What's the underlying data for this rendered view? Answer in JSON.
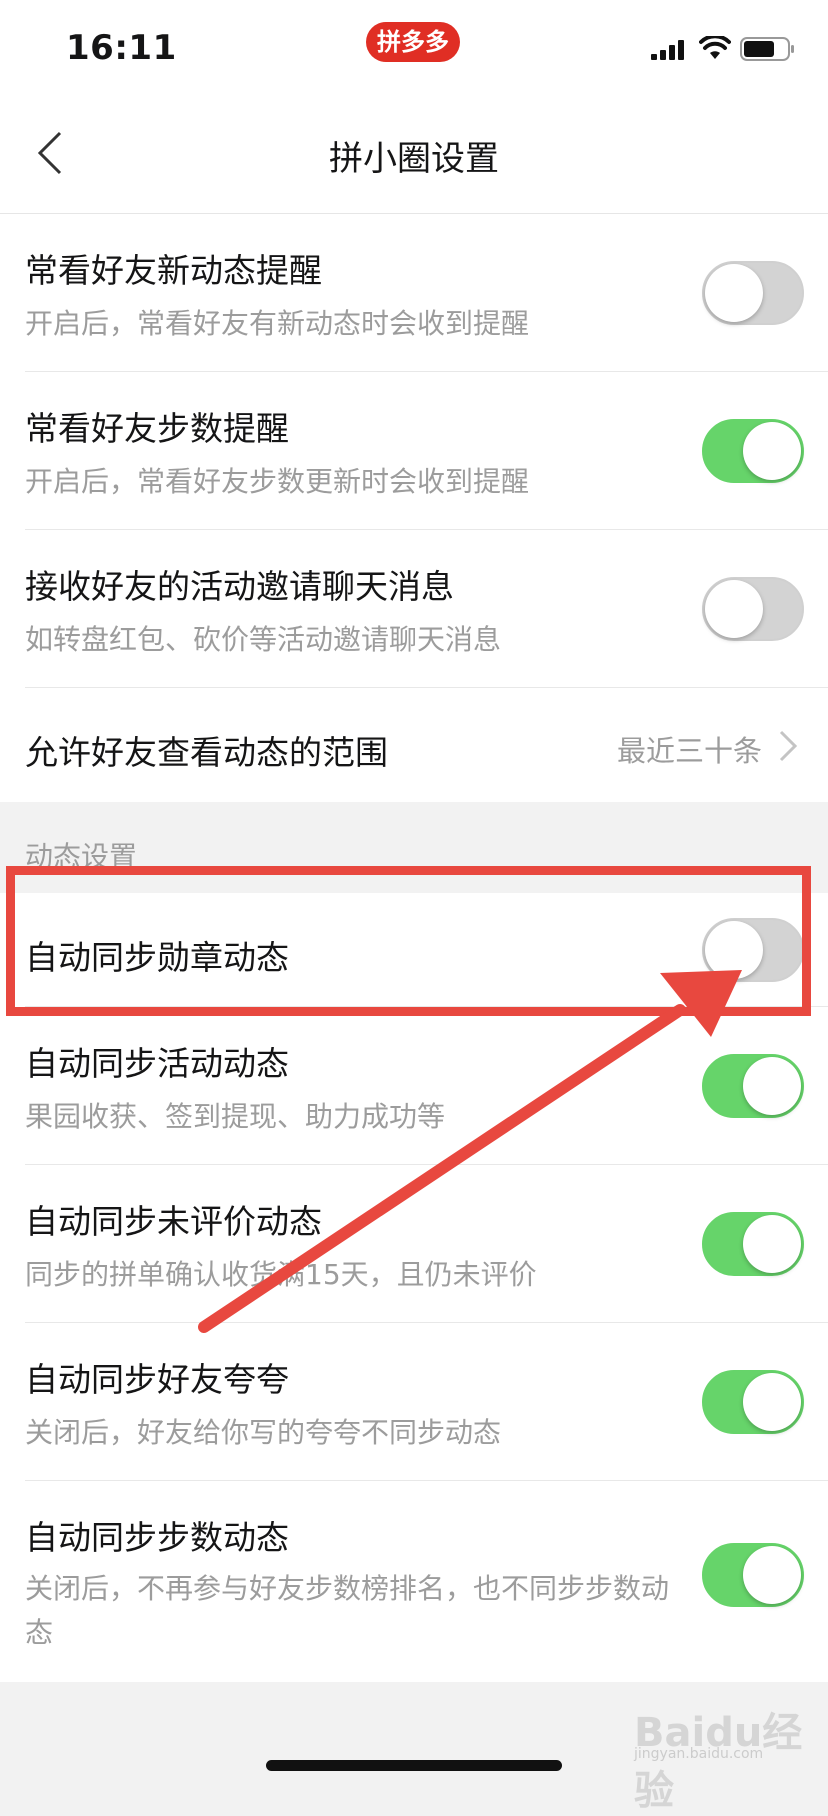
{
  "status_bar": {
    "time": "16:11",
    "app_badge": "拼多多"
  },
  "nav": {
    "title": "拼小圈设置"
  },
  "settings_top": [
    {
      "title": "常看好友新动态提醒",
      "desc": "开启后，常看好友有新动态时会收到提醒",
      "on": false
    },
    {
      "title": "常看好友步数提醒",
      "desc": "开启后，常看好友步数更新时会收到提醒",
      "on": true
    },
    {
      "title": "接收好友的活动邀请聊天消息",
      "desc": "如转盘红包、砍价等活动邀请聊天消息",
      "on": false
    }
  ],
  "view_range": {
    "title": "允许好友查看动态的范围",
    "value": "最近三十条"
  },
  "dynamic_section": {
    "header": "动态设置",
    "items": [
      {
        "title": "自动同步勋章动态",
        "desc": "",
        "on": false
      },
      {
        "title": "自动同步活动动态",
        "desc": "果园收获、签到提现、助力成功等",
        "on": true
      },
      {
        "title": "自动同步未评价动态",
        "desc": "同步的拼单确认收货满15天，且仍未评价",
        "on": true
      },
      {
        "title": "自动同步好友夸夸",
        "desc": "关闭后，好友给你写的夸夸不同步动态",
        "on": true
      },
      {
        "title": "自动同步步数动态",
        "desc": "关闭后，不再参与好友步数榜排名，也不同步步数动态",
        "on": true
      }
    ]
  },
  "watermark": {
    "text": "Baidu经验",
    "sub": "jingyan.baidu.com"
  },
  "colors": {
    "brand": "#e02e24",
    "toggle_on": "#66d46a",
    "annotation": "#e8483f"
  }
}
